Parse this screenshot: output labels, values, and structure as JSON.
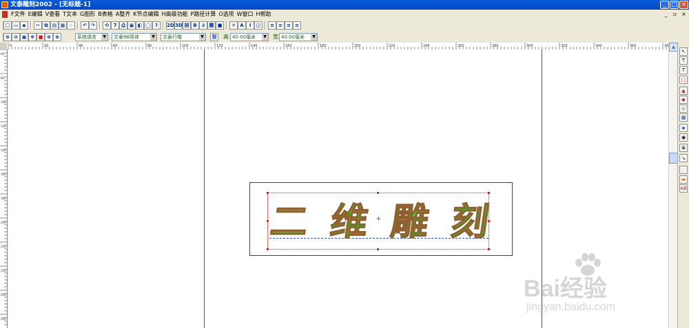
{
  "window": {
    "title": "文泰雕刻2002 - [无标题-1]",
    "controls": {
      "minimize": "_",
      "maximize": "□",
      "close": "×"
    },
    "mdi_controls": {
      "minimize": "_",
      "restore": "▫",
      "close": "×"
    }
  },
  "menu": {
    "items": [
      {
        "label": "F文件"
      },
      {
        "label": "E编辑"
      },
      {
        "label": "V查看"
      },
      {
        "label": "T文本"
      },
      {
        "label": "G图形"
      },
      {
        "label": "B表格"
      },
      {
        "label": "A整齐"
      },
      {
        "label": "K节点编辑"
      },
      {
        "label": "H高级功能"
      },
      {
        "label": "P路径计算"
      },
      {
        "label": "O选项"
      },
      {
        "label": "W窗口"
      },
      {
        "label": "H帮助"
      }
    ]
  },
  "toolbar1": {
    "buttons": [
      {
        "name": "new-icon",
        "glyph": "□"
      },
      {
        "name": "open-icon",
        "glyph": "▭"
      },
      {
        "name": "save-icon",
        "glyph": "▪"
      },
      {
        "name": "cut-icon",
        "glyph": "✂"
      },
      {
        "name": "copy-icon",
        "glyph": "⧉"
      },
      {
        "name": "paste-icon",
        "glyph": "▤"
      },
      {
        "name": "grid-icon",
        "glyph": "▦"
      },
      {
        "name": "disabled-icon",
        "glyph": "▫"
      },
      {
        "name": "undo-icon",
        "glyph": "↶"
      },
      {
        "name": "redo-icon",
        "glyph": "↷"
      },
      {
        "name": "rotate-icon",
        "glyph": "⟲"
      },
      {
        "name": "seven-icon",
        "glyph": "7"
      },
      {
        "name": "print-icon",
        "glyph": "⎙"
      },
      {
        "name": "preview-icon",
        "glyph": "▣"
      },
      {
        "name": "export-icon",
        "glyph": "◧"
      },
      {
        "name": "bulb-icon",
        "glyph": "◯"
      },
      {
        "name": "help-icon",
        "glyph": "?"
      },
      {
        "name": "two-d-icon",
        "glyph": "2D"
      },
      {
        "name": "three-d-icon",
        "glyph": "3D"
      },
      {
        "name": "engrave-icon",
        "glyph": "刻"
      },
      {
        "name": "b-mode-icon",
        "glyph": "B"
      },
      {
        "name": "path-icon",
        "glyph": "∂"
      },
      {
        "name": "carve-icon",
        "glyph": "雕"
      },
      {
        "name": "shapes-icon",
        "glyph": "■"
      },
      {
        "name": "cross-icon",
        "glyph": "✕"
      },
      {
        "name": "text-a-icon",
        "glyph": "A"
      },
      {
        "name": "italic-icon",
        "glyph": "I"
      },
      {
        "name": "frame-icon",
        "glyph": "◫"
      },
      {
        "name": "align-left-icon",
        "glyph": "≡"
      },
      {
        "name": "align-center-icon",
        "glyph": "≡"
      },
      {
        "name": "align-right-icon",
        "glyph": "≡"
      },
      {
        "name": "justify-icon",
        "glyph": "≡"
      }
    ]
  },
  "toolbar2": {
    "zoom_buttons": [
      {
        "name": "zoom-in-icon",
        "glyph": "⊕"
      },
      {
        "name": "zoom-out-icon",
        "glyph": "⊖"
      },
      {
        "name": "zoom-page-icon",
        "glyph": "▣"
      },
      {
        "name": "pan-icon",
        "glyph": "✥"
      },
      {
        "name": "color-fill-icon",
        "glyph": "■"
      },
      {
        "name": "zoom-select-icon",
        "glyph": "⊕"
      },
      {
        "name": "zoom-fit-icon",
        "glyph": "⊗"
      }
    ],
    "language": "系统语言",
    "font": "文泰98简体",
    "style": "文泰行楷",
    "format_icon": "型",
    "height_label": "高",
    "height_value": "40.00毫米",
    "width_label": "宽",
    "width_value": "40.00毫米"
  },
  "canvas": {
    "ruler_h_labels": [
      "0",
      "20",
      "40",
      "60",
      "80",
      "100",
      "120",
      "140",
      "160",
      "180",
      "200",
      "220",
      "240",
      "260",
      "280",
      "300",
      "320",
      "340",
      "360",
      "380",
      "400",
      "420",
      "440",
      "460",
      "480",
      "500",
      "520",
      "540",
      "560",
      "580"
    ],
    "ruler_v_labels": [
      "60",
      "80",
      "100",
      "120",
      "140",
      "160",
      "180",
      "200",
      "220",
      "240",
      "260",
      "280"
    ],
    "art_text": [
      "二",
      "维",
      "雕",
      "刻"
    ],
    "center_mark": "+",
    "fill_color": "#22e022",
    "outline_color": "#906030"
  },
  "toolbox": {
    "tools": [
      {
        "name": "arrow-select-icon",
        "glyph": "↖"
      },
      {
        "name": "text-tool-icon",
        "glyph": "T"
      },
      {
        "name": "vertical-text-icon",
        "glyph": "T"
      },
      {
        "name": "rectangle-tool-icon",
        "glyph": "□"
      },
      {
        "name": "paint-fill-icon",
        "glyph": "▲"
      },
      {
        "name": "fill-color-icon",
        "glyph": "◆"
      },
      {
        "name": "shape-tool-icon",
        "glyph": "◇"
      },
      {
        "name": "table-tool-icon",
        "glyph": "▦"
      },
      {
        "name": "palette-icon",
        "glyph": "▪"
      },
      {
        "name": "effects-icon",
        "glyph": "◉"
      },
      {
        "name": "list-tool-icon",
        "glyph": "≣"
      },
      {
        "name": "node-tool-icon",
        "glyph": "↘"
      },
      {
        "name": "disabled-tool-icon",
        "glyph": "◌"
      },
      {
        "name": "mask-tool-icon",
        "glyph": "▬"
      },
      {
        "name": "ab-text-icon",
        "glyph": "AB"
      }
    ]
  },
  "watermark": {
    "brand": "Bai经验",
    "url": "jingyan.baidu.com"
  }
}
